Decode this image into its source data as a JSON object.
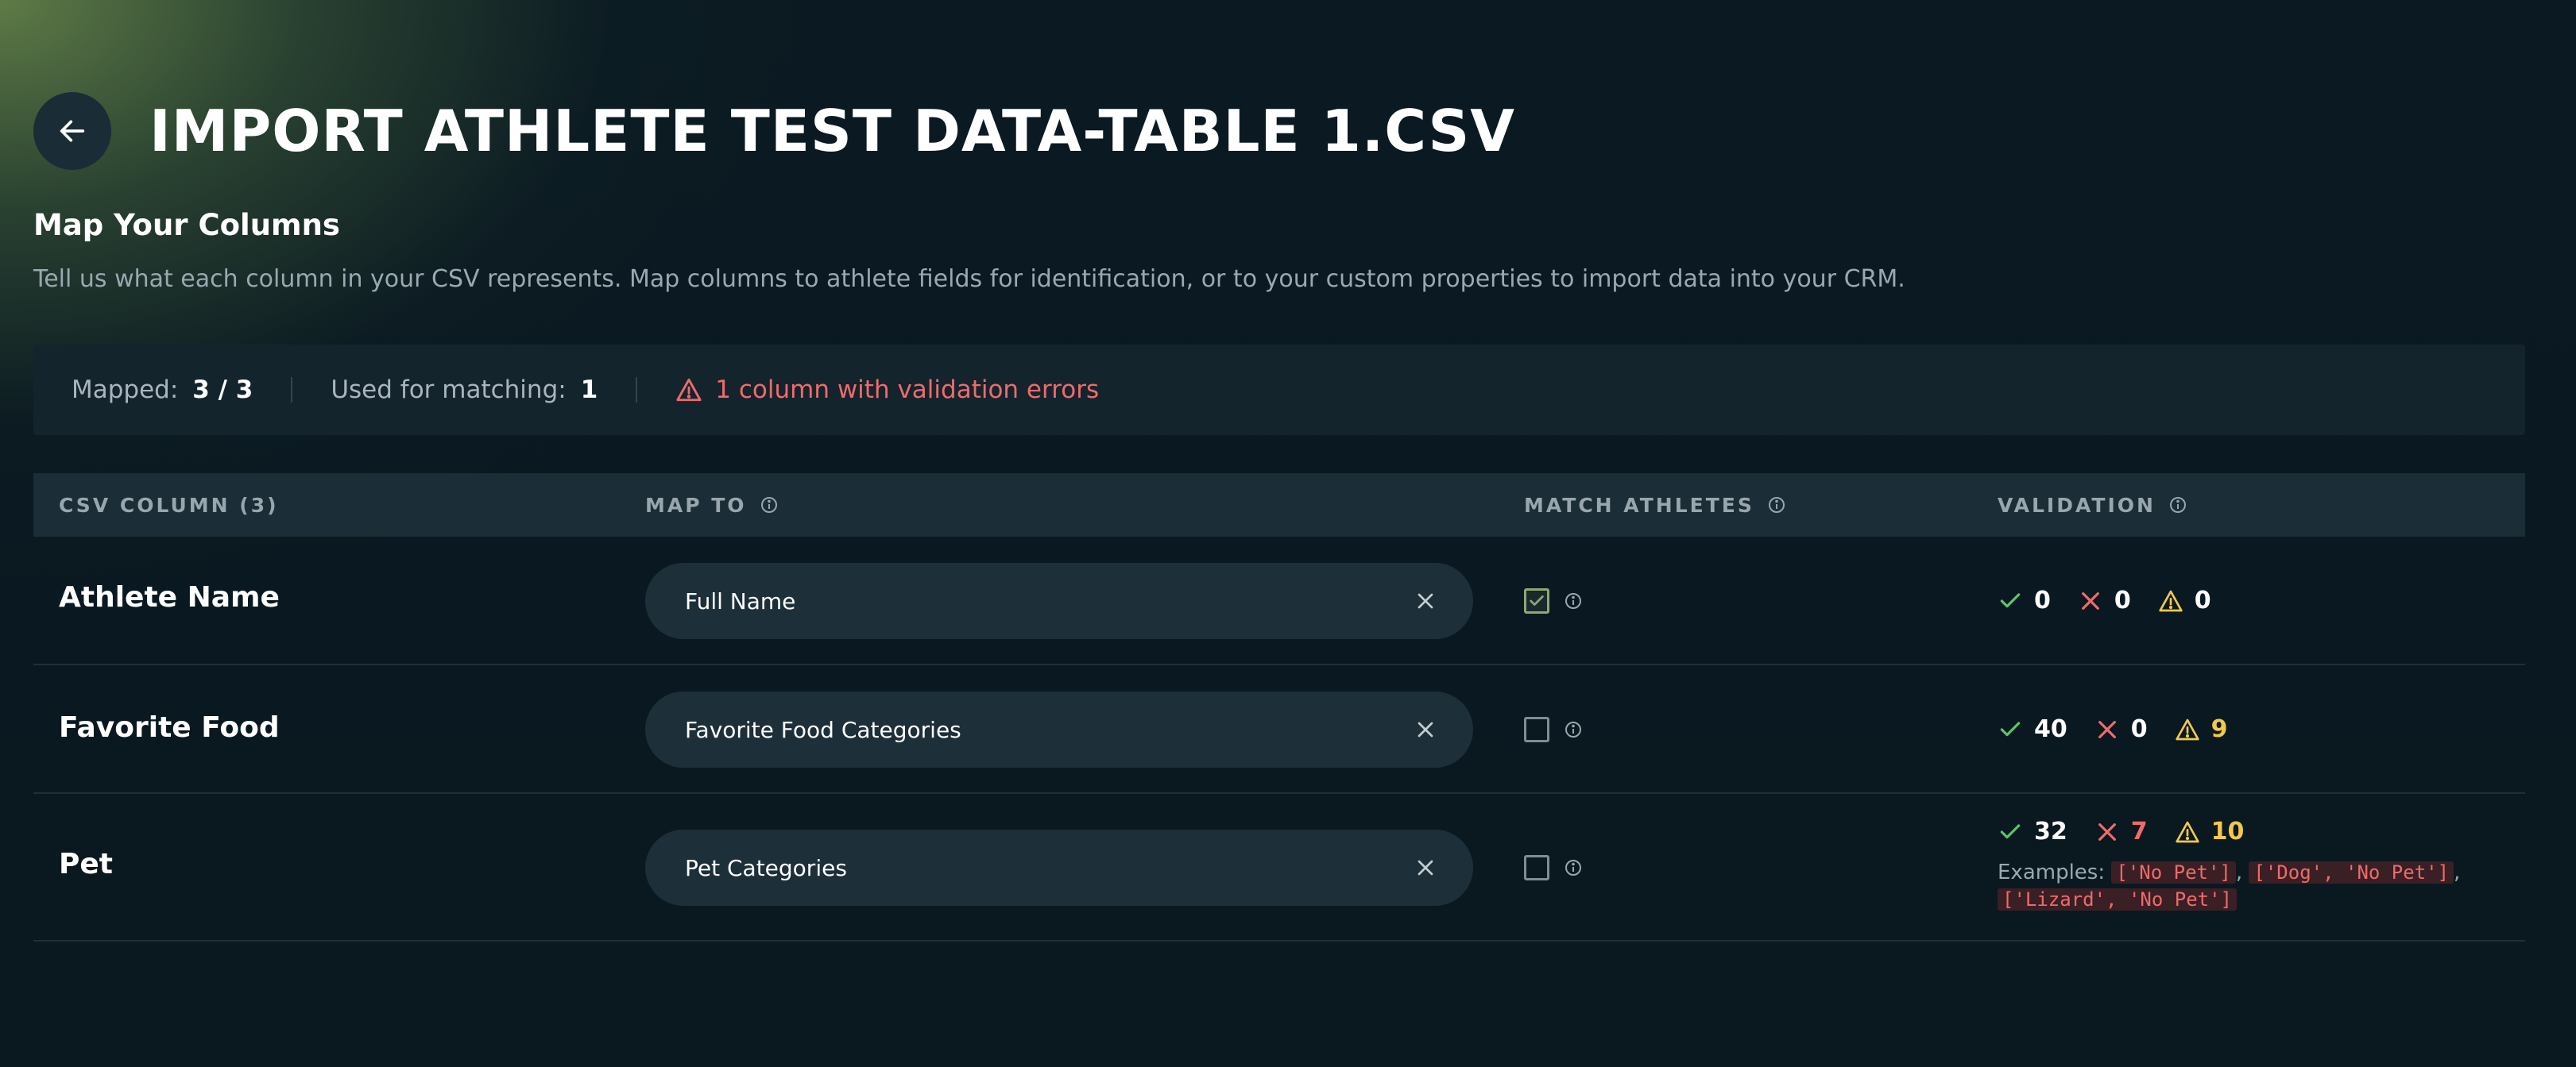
{
  "header": {
    "title": "IMPORT ATHLETE TEST DATA-TABLE 1.CSV"
  },
  "section": {
    "title": "Map Your Columns",
    "description": "Tell us what each column in your CSV represents. Map columns to athlete fields for identification, or to your custom properties to import data into your CRM."
  },
  "summary": {
    "mapped_label": "Mapped:",
    "mapped_value": "3 / 3",
    "matching_label": "Used for matching:",
    "matching_value": "1",
    "error_text": "1 column with validation errors"
  },
  "table": {
    "headers": {
      "csv_column": "CSV COLUMN (3)",
      "map_to": "MAP TO",
      "match_athletes": "MATCH ATHLETES",
      "validation": "VALIDATION"
    },
    "rows": [
      {
        "name": "Athlete Name",
        "map_to": "Full Name",
        "match": true,
        "valid": "0",
        "invalid": "0",
        "warnings": "0"
      },
      {
        "name": "Favorite Food",
        "map_to": "Favorite Food Categories",
        "match": false,
        "valid": "40",
        "invalid": "0",
        "warnings": "9"
      },
      {
        "name": "Pet",
        "map_to": "Pet Categories",
        "match": false,
        "valid": "32",
        "invalid": "7",
        "warnings": "10",
        "examples_label": "Examples:",
        "examples": [
          "['No Pet']",
          "['Dog', 'No Pet']",
          "['Lizard', 'No Pet']"
        ],
        "examples_sep": ","
      }
    ]
  },
  "colors": {
    "success": "#5fc26a",
    "error": "#ef6b6b",
    "warning": "#f2c94c",
    "checkbox_checked": "#8fa872"
  },
  "icons": {
    "back": "arrow-left-icon",
    "warning": "warning-triangle-icon",
    "info": "info-circle-icon",
    "clear": "close-icon",
    "valid": "check-icon",
    "invalid": "x-icon"
  }
}
